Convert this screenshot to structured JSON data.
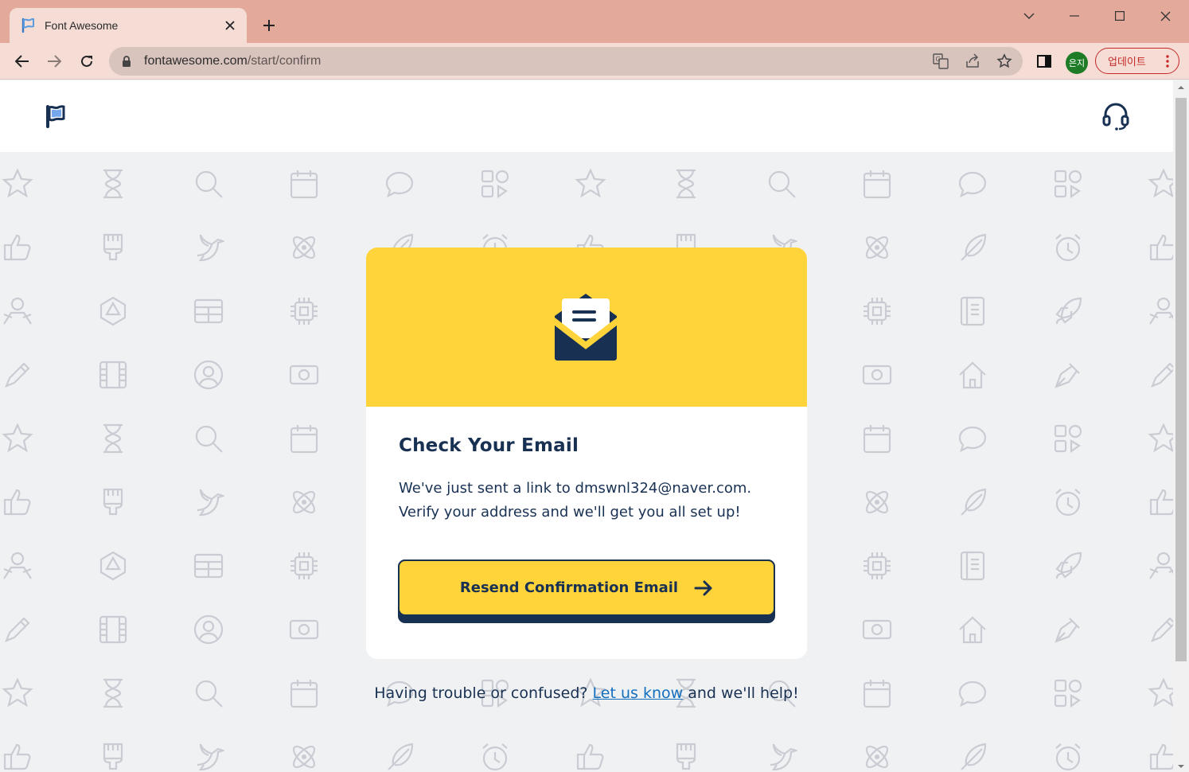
{
  "browser": {
    "tab_title": "Font Awesome",
    "url_host": "fontawesome.com",
    "url_path": "/start/confirm",
    "profile_initials": "은지",
    "update_label": "업데이트",
    "accent_color": "#e3aa9b"
  },
  "header": {
    "logo_icon": "flag-icon",
    "support_icon": "headset-icon"
  },
  "card": {
    "hero_icon": "envelope-open-text-icon",
    "title": "Check Your Email",
    "message_line1": "We've just sent a link to dmswnl324@naver.com.",
    "message_line2": "Verify your address and we'll get you all set up!",
    "button_label": "Resend Confirmation Email",
    "button_icon": "arrow-right-icon",
    "hero_color": "#ffd43b",
    "ink_color": "#183153"
  },
  "footer": {
    "help_prefix": "Having trouble or confused?",
    "help_link": "Let us know",
    "help_suffix": "and we'll help!"
  }
}
